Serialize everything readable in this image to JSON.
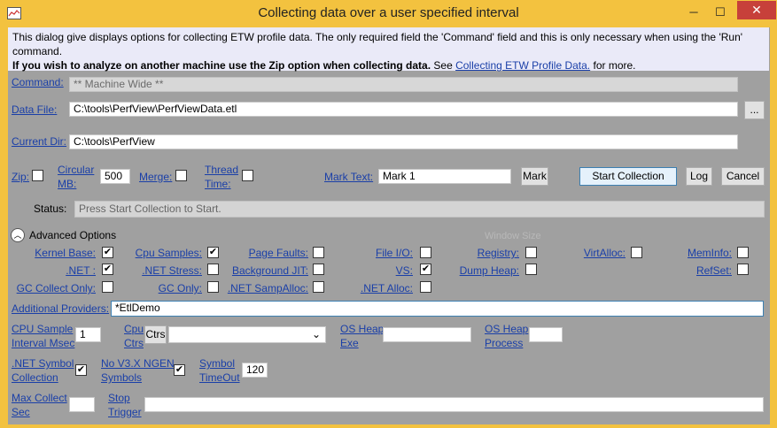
{
  "window": {
    "title": "Collecting data over a user specified interval",
    "minimize": "─",
    "maximize": "☐",
    "close": "✕"
  },
  "info": {
    "line1": "This dialog give displays options for collecting ETW profile data. The only required field the 'Command' field and this is only necessary when using the 'Run'",
    "line2": "command.",
    "bold": "If you wish to analyze on another machine use the Zip option when collecting data.",
    "see": " See ",
    "link": "Collecting ETW Profile Data.",
    "more": " for more."
  },
  "command": {
    "label": "Command:",
    "value": "** Machine Wide **"
  },
  "data_file": {
    "label": "Data File:",
    "value": "C:\\tools\\PerfView\\PerfViewData.etl",
    "browse": "..."
  },
  "current_dir": {
    "label": "Current Dir:",
    "value": "C:\\tools\\PerfView"
  },
  "options": {
    "zip": "Zip:",
    "circular_1": "Circular",
    "circular_2": "MB:",
    "circular_value": "500",
    "merge": "Merge:",
    "thread_1": "Thread",
    "thread_2": "Time:",
    "mark_text_label": "Mark Text:",
    "mark_text_value": "Mark 1",
    "mark_button": "Mark",
    "start_button": "Start Collection",
    "log_button": "Log",
    "cancel_button": "Cancel"
  },
  "status": {
    "label": "Status:",
    "value": "Press Start Collection to Start."
  },
  "advanced": {
    "label": "Advanced Options",
    "toggle": "︿",
    "window_size": "Window Size"
  },
  "providers": {
    "kernel_base": {
      "label": "Kernel Base:",
      "checked": "✔"
    },
    "cpu_samples": {
      "label": "Cpu Samples:",
      "checked": "✔"
    },
    "page_faults": {
      "label": "Page Faults:",
      "checked": ""
    },
    "file_io": {
      "label": "File I/O:",
      "checked": ""
    },
    "registry": {
      "label": "Registry:",
      "checked": ""
    },
    "virt_alloc": {
      "label": "VirtAlloc:",
      "checked": ""
    },
    "mem_info": {
      "label": "MemInfo:",
      "checked": ""
    },
    "net": {
      "label": ".NET :",
      "checked": "✔"
    },
    "net_stress": {
      "label": ".NET Stress:",
      "checked": ""
    },
    "background_jit": {
      "label": "Background JIT:",
      "checked": ""
    },
    "vs": {
      "label": "VS:",
      "checked": "✔"
    },
    "dump_heap": {
      "label": "Dump Heap:",
      "checked": ""
    },
    "ref_set": {
      "label": "RefSet:",
      "checked": ""
    },
    "gc_collect_only": {
      "label": "GC Collect Only:",
      "checked": ""
    },
    "gc_only": {
      "label": "GC Only:",
      "checked": ""
    },
    "net_samp_alloc": {
      "label": ".NET SampAlloc:",
      "checked": ""
    },
    "net_alloc": {
      "label": ".NET Alloc:",
      "checked": ""
    }
  },
  "additional_providers": {
    "label": "Additional Providers:",
    "value": "*EtlDemo"
  },
  "cpu_sample": {
    "label_1": "CPU Sample",
    "label_2": "Interval Msec",
    "value": "1"
  },
  "cpu_ctrs": {
    "label_1": "Cpu",
    "label_2": "Ctrs",
    "button": "Ctrs",
    "chevron": "⌄"
  },
  "os_heap_exe": {
    "label_1": "OS Heap",
    "label_2": "Exe",
    "value": ""
  },
  "os_heap_process": {
    "label_1": "OS Heap",
    "label_2": "Process",
    "value": ""
  },
  "net_symbol": {
    "label_1": ".NET Symbol",
    "label_2": "Collection",
    "checked": "✔"
  },
  "no_v3x": {
    "label_1": "No V3.X NGEN",
    "label_2": "Symbols",
    "checked": "✔"
  },
  "symbol_timeout": {
    "label_1": "Symbol",
    "label_2": "TimeOut",
    "value": "120"
  },
  "max_collect": {
    "label_1": "Max Collect",
    "label_2": "Sec",
    "value": ""
  },
  "stop_trigger": {
    "label_1": "Stop",
    "label_2": "Trigger",
    "value": ""
  }
}
